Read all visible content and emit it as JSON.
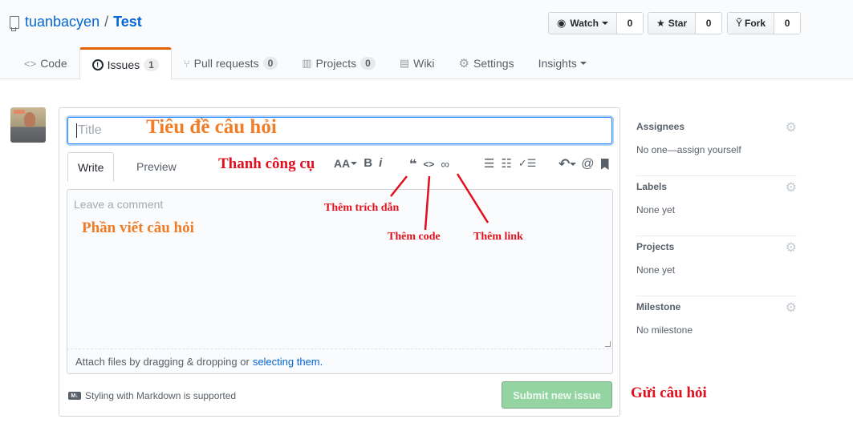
{
  "repo": {
    "owner": "tuanbacyen",
    "separator": "/",
    "name": "Test"
  },
  "actions": [
    {
      "label": "Watch",
      "icon": "eye-icon",
      "count": "0",
      "has_caret": true
    },
    {
      "label": "Star",
      "icon": "star-icon",
      "count": "0"
    },
    {
      "label": "Fork",
      "icon": "fork-icon",
      "count": "0"
    }
  ],
  "tabs": [
    {
      "label": "Code",
      "icon": "<>"
    },
    {
      "label": "Issues",
      "icon": "!",
      "count": "1",
      "selected": true
    },
    {
      "label": "Pull requests",
      "icon": "⑂",
      "count": "0"
    },
    {
      "label": "Projects",
      "icon": "▥",
      "count": "0"
    },
    {
      "label": "Wiki",
      "icon": "▤"
    },
    {
      "label": "Settings",
      "icon": "⚙"
    },
    {
      "label": "Insights",
      "has_caret": true
    }
  ],
  "form": {
    "title_placeholder": "Title",
    "write_tab": "Write",
    "preview_tab": "Preview",
    "comment_placeholder": "Leave a comment",
    "attach_text": "Attach files by dragging & dropping or",
    "attach_link": "selecting them.",
    "markdown_note": "Styling with Markdown is supported",
    "markdown_icon": "M↓",
    "submit_label": "Submit new issue"
  },
  "toolbar": {
    "header": "AA",
    "bold": "B",
    "italic": "i",
    "quote": "❝",
    "code": "<>",
    "link": "∞",
    "unordered_list": "☰",
    "ordered_list": "☷",
    "task_list": "✓☰",
    "reply": "↶",
    "mention": "@",
    "bookmark": "🔖"
  },
  "sidebar": [
    {
      "heading": "Assignees",
      "value": "No one—assign yourself"
    },
    {
      "heading": "Labels",
      "value": "None yet"
    },
    {
      "heading": "Projects",
      "value": "None yet"
    },
    {
      "heading": "Milestone",
      "value": "No milestone"
    }
  ],
  "annotations": {
    "title": "Tiêu đề câu hỏi",
    "toolbar": "Thanh công cụ",
    "body": "Phần viết câu hỏi",
    "quote": "Thêm trích dẫn",
    "code": "Thêm code",
    "link": "Thêm link",
    "submit": "Gửi câu hỏi"
  },
  "colors": {
    "accent": "#e36209",
    "link": "#0366d6",
    "submit_disabled": "#94d3a2",
    "annotation_orange": "#f07d28",
    "annotation_red": "#e0101f"
  }
}
